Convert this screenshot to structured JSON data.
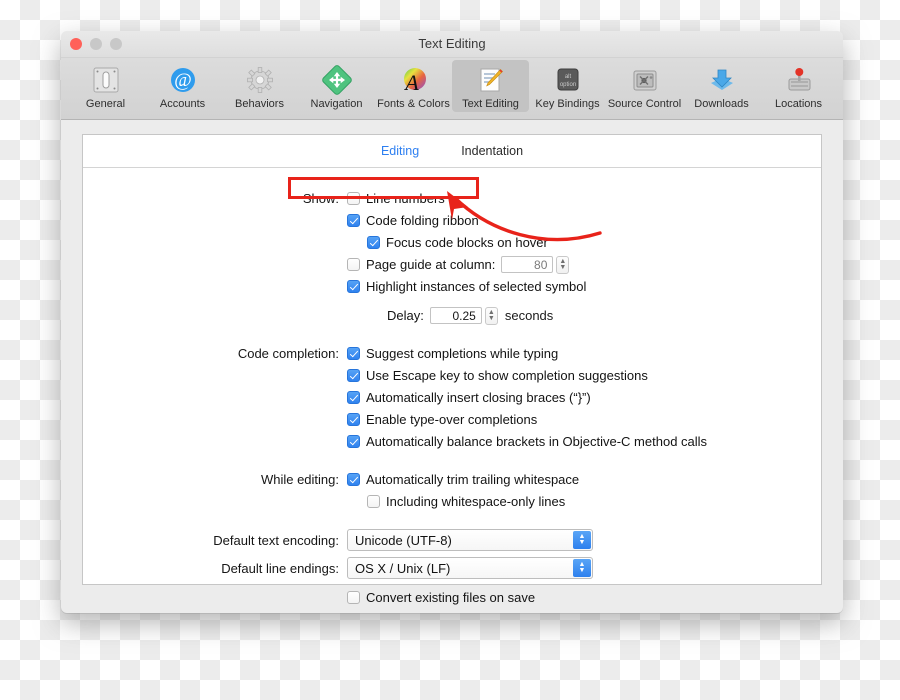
{
  "window": {
    "title": "Text Editing",
    "traffic_lights": [
      "close-button",
      "minimize-button",
      "zoom-button"
    ]
  },
  "toolbar": {
    "items": [
      {
        "label": "General",
        "icon": "general-switch-icon",
        "selected": false
      },
      {
        "label": "Accounts",
        "icon": "at-sign-icon",
        "selected": false
      },
      {
        "label": "Behaviors",
        "icon": "gear-icon",
        "selected": false
      },
      {
        "label": "Navigation",
        "icon": "move-arrows-icon",
        "selected": false
      },
      {
        "label": "Fonts & Colors",
        "icon": "font-color-wheel-icon",
        "selected": false
      },
      {
        "label": "Text Editing",
        "icon": "pencil-page-icon",
        "selected": true
      },
      {
        "label": "Key Bindings",
        "icon": "option-keycap-icon",
        "selected": false
      },
      {
        "label": "Source Control",
        "icon": "safe-vault-icon",
        "selected": false
      },
      {
        "label": "Downloads",
        "icon": "download-arrow-icon",
        "selected": false
      },
      {
        "label": "Locations",
        "icon": "disk-pin-icon",
        "selected": false
      }
    ]
  },
  "tabs": [
    {
      "label": "Editing",
      "active": true
    },
    {
      "label": "Indentation",
      "active": false
    }
  ],
  "form": {
    "show_label": "Show:",
    "line_numbers": {
      "label": "Line numbers",
      "checked": false
    },
    "code_folding_ribbon": {
      "label": "Code folding ribbon",
      "checked": true
    },
    "focus_code_blocks": {
      "label": "Focus code blocks on hover",
      "checked": true
    },
    "page_guide": {
      "label": "Page guide at column:",
      "checked": false,
      "value": "80"
    },
    "highlight_instances": {
      "label": "Highlight instances of selected symbol",
      "checked": true
    },
    "delay_label": "Delay:",
    "delay_value": "0.25",
    "delay_unit": "seconds",
    "code_completion_label": "Code completion:",
    "code_completion_items": [
      {
        "label": "Suggest completions while typing",
        "checked": true
      },
      {
        "label": "Use Escape key to show completion suggestions",
        "checked": true
      },
      {
        "label": "Automatically insert closing braces (“}”)",
        "checked": true
      },
      {
        "label": "Enable type-over completions",
        "checked": true
      },
      {
        "label": "Automatically balance brackets in Objective-C method calls",
        "checked": true
      }
    ],
    "while_editing_label": "While editing:",
    "trim_whitespace": {
      "label": "Automatically trim trailing whitespace",
      "checked": true
    },
    "including_whitespace_only": {
      "label": "Including whitespace-only lines",
      "checked": false
    },
    "encoding_label": "Default text encoding:",
    "encoding_value": "Unicode (UTF-8)",
    "line_endings_label": "Default line endings:",
    "line_endings_value": "OS X / Unix (LF)",
    "convert_on_save": {
      "label": "Convert existing files on save",
      "checked": false
    }
  },
  "annotation": {
    "highlight_target": "Line numbers row",
    "box_color": "#e8231a",
    "arrow_color": "#e8231a"
  }
}
